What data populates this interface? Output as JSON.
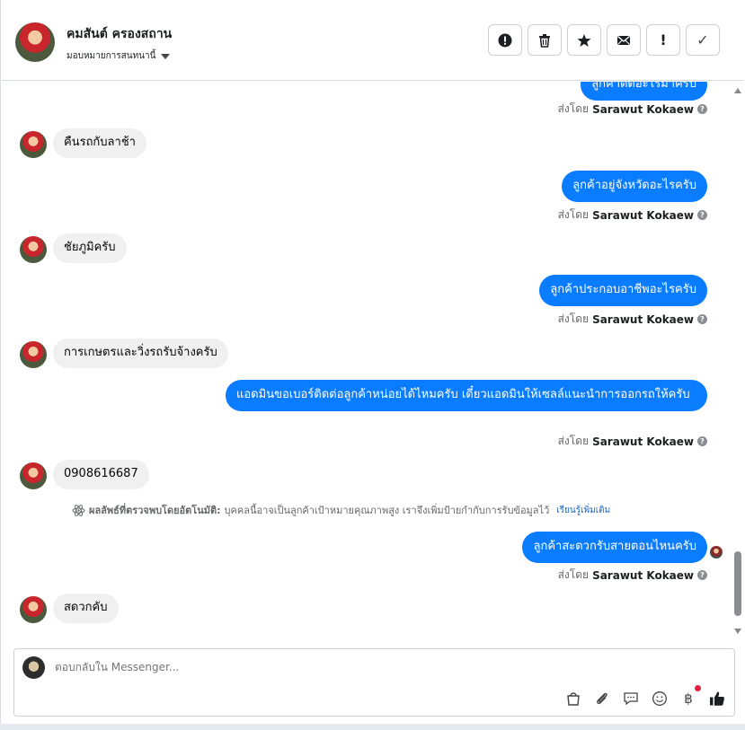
{
  "header": {
    "contact_name": "คมสันต์ ครองสถาน",
    "assign_label": "มอบหมายการสนทนานี้",
    "actions": [
      {
        "name": "report-spam-button",
        "icon": "exclamation-circle-icon"
      },
      {
        "name": "delete-button",
        "icon": "trash-icon"
      },
      {
        "name": "star-button",
        "icon": "star-icon"
      },
      {
        "name": "mark-unread-button",
        "icon": "envelope-icon"
      },
      {
        "name": "follow-up-button",
        "icon": "exclamation-icon",
        "symbol": "!"
      },
      {
        "name": "mark-done-button",
        "icon": "check-icon",
        "symbol": "✓"
      }
    ]
  },
  "messages": {
    "out_0_partial": "ลูกค้าติดอะไรมาครับ",
    "in_1": "คืนรถกับลาช้า",
    "out_2": "ลูกค้าอยู่จังหวัดอะไรครับ",
    "in_3": "ชัยภูมิครับ",
    "out_4": "ลูกค้าประกอบอาชีพอะไรครับ",
    "in_5": "การเกษตรและวิ่งรถรับจ้างครับ",
    "out_6": "แอดมินขอเบอร์ติดต่อลูกค้าหน่อยได้ไหมครับ เดี๋ยวแอดมินให้เซลล์แนะนำการออกรถให้ครับ",
    "in_7": "0908616687",
    "out_8": "ลูกค้าสะดวกรับสายตอนไหนครับ",
    "in_9": "สดวกคับ"
  },
  "sent_by": {
    "prefix": "ส่งโดย",
    "agent": "Sarawut Kokaew",
    "help_icon": "?"
  },
  "detection": {
    "icon": "atom-icon",
    "title": "ผลลัพธ์ที่ตรวจพบโดยอัตโนมัติ:",
    "text": "บุคคลนี้อาจเป็นลูกค้าเป้าหมายคุณภาพสูง เราจึงเพิ่มป้ายกำกับการรับข้อมูลไว้",
    "link": "เรียนรู้เพิ่มเติม"
  },
  "composer": {
    "placeholder": "ตอบกลับใน Messenger...",
    "tools": [
      "saved-replies-icon",
      "attachment-icon",
      "message-icon",
      "emoji-icon",
      "baht-payment-icon",
      "like-icon"
    ],
    "baht_symbol": "฿"
  },
  "colors": {
    "outgoing_bubble": "#0a7cff",
    "incoming_bubble": "#f0f0f0",
    "link": "#1b66c9"
  }
}
